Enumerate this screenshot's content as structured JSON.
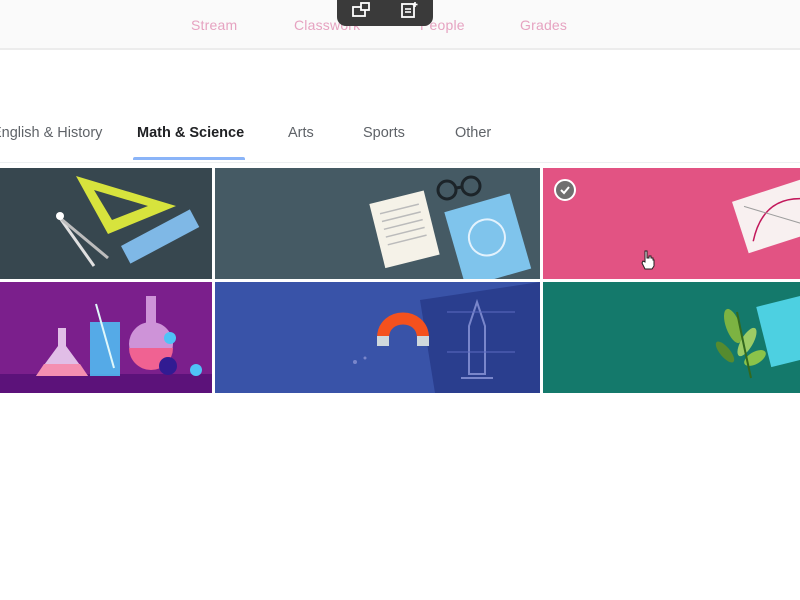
{
  "top_nav": {
    "tabs": [
      {
        "label": "Stream"
      },
      {
        "label": "Classwork"
      },
      {
        "label": "People"
      },
      {
        "label": "Grades"
      }
    ]
  },
  "toolbar": {
    "icons": [
      "share-screen-icon",
      "add-note-icon"
    ]
  },
  "theme_picker": {
    "tabs": [
      {
        "label": "English & History",
        "active": false
      },
      {
        "label": "Math & Science",
        "active": true
      },
      {
        "label": "Arts",
        "active": false
      },
      {
        "label": "Sports",
        "active": false
      },
      {
        "label": "Other",
        "active": false
      }
    ],
    "active_tab_color": "#8ab4f8",
    "themes": [
      {
        "icon": "geometry-tools-icon",
        "color": "#37474f",
        "selected": false
      },
      {
        "icon": "notebook-glasses-icon",
        "color": "#455a64",
        "selected": false
      },
      {
        "icon": "graph-paper-icon",
        "color": "#e25383",
        "selected": true
      },
      {
        "icon": "chemistry-flask-icon",
        "color": "#7b1f8c",
        "selected": false
      },
      {
        "icon": "magnet-rocket-icon",
        "color": "#3953a8",
        "selected": false
      },
      {
        "icon": "plant-leaves-icon",
        "color": "#14796b",
        "selected": false
      }
    ]
  }
}
